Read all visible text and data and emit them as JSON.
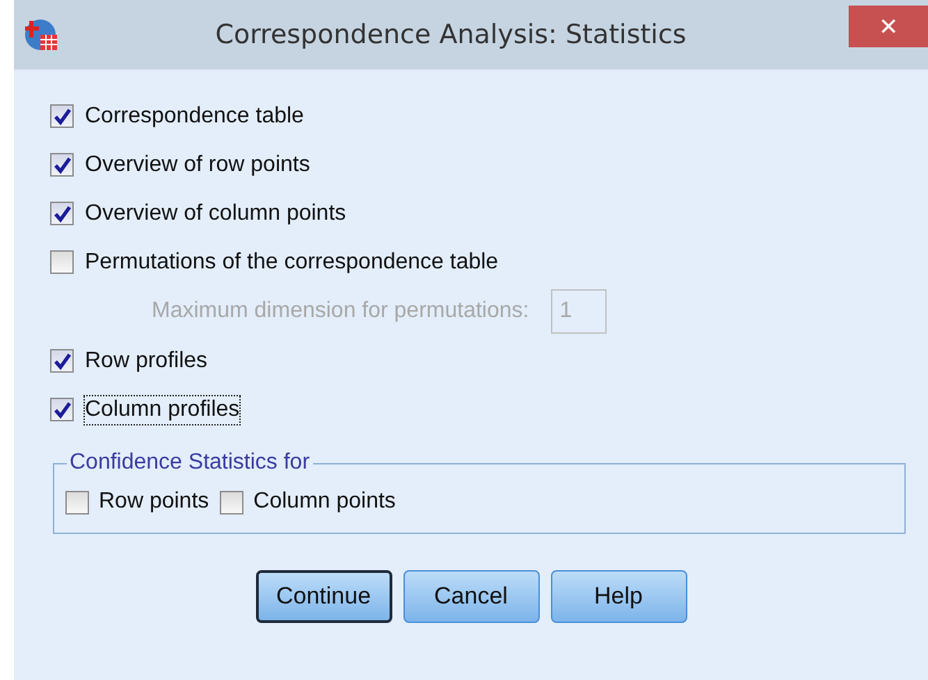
{
  "window": {
    "title": "Correspondence Analysis: Statistics",
    "close": "✕"
  },
  "options": [
    {
      "kind": "checkbox",
      "label": "Correspondence table",
      "checked": true,
      "focused": false
    },
    {
      "kind": "checkbox",
      "label": "Overview of row points",
      "checked": true,
      "focused": false
    },
    {
      "kind": "checkbox",
      "label": "Overview of column points",
      "checked": true,
      "focused": false
    },
    {
      "kind": "checkbox",
      "label": "Permutations of the correspondence table",
      "checked": false,
      "focused": false
    },
    {
      "kind": "field",
      "label": "Maximum dimension for permutations:",
      "value": "1",
      "disabled": true
    },
    {
      "kind": "checkbox",
      "label": "Row profiles",
      "checked": true,
      "focused": false
    },
    {
      "kind": "checkbox",
      "label": "Column profiles",
      "checked": true,
      "focused": true
    }
  ],
  "confidence": {
    "title": "Confidence Statistics for",
    "items": [
      {
        "label": "Row points",
        "checked": false
      },
      {
        "label": "Column points",
        "checked": false
      }
    ]
  },
  "buttons": [
    {
      "label": "Continue",
      "default": true
    },
    {
      "label": "Cancel",
      "default": false
    },
    {
      "label": "Help",
      "default": false
    }
  ]
}
